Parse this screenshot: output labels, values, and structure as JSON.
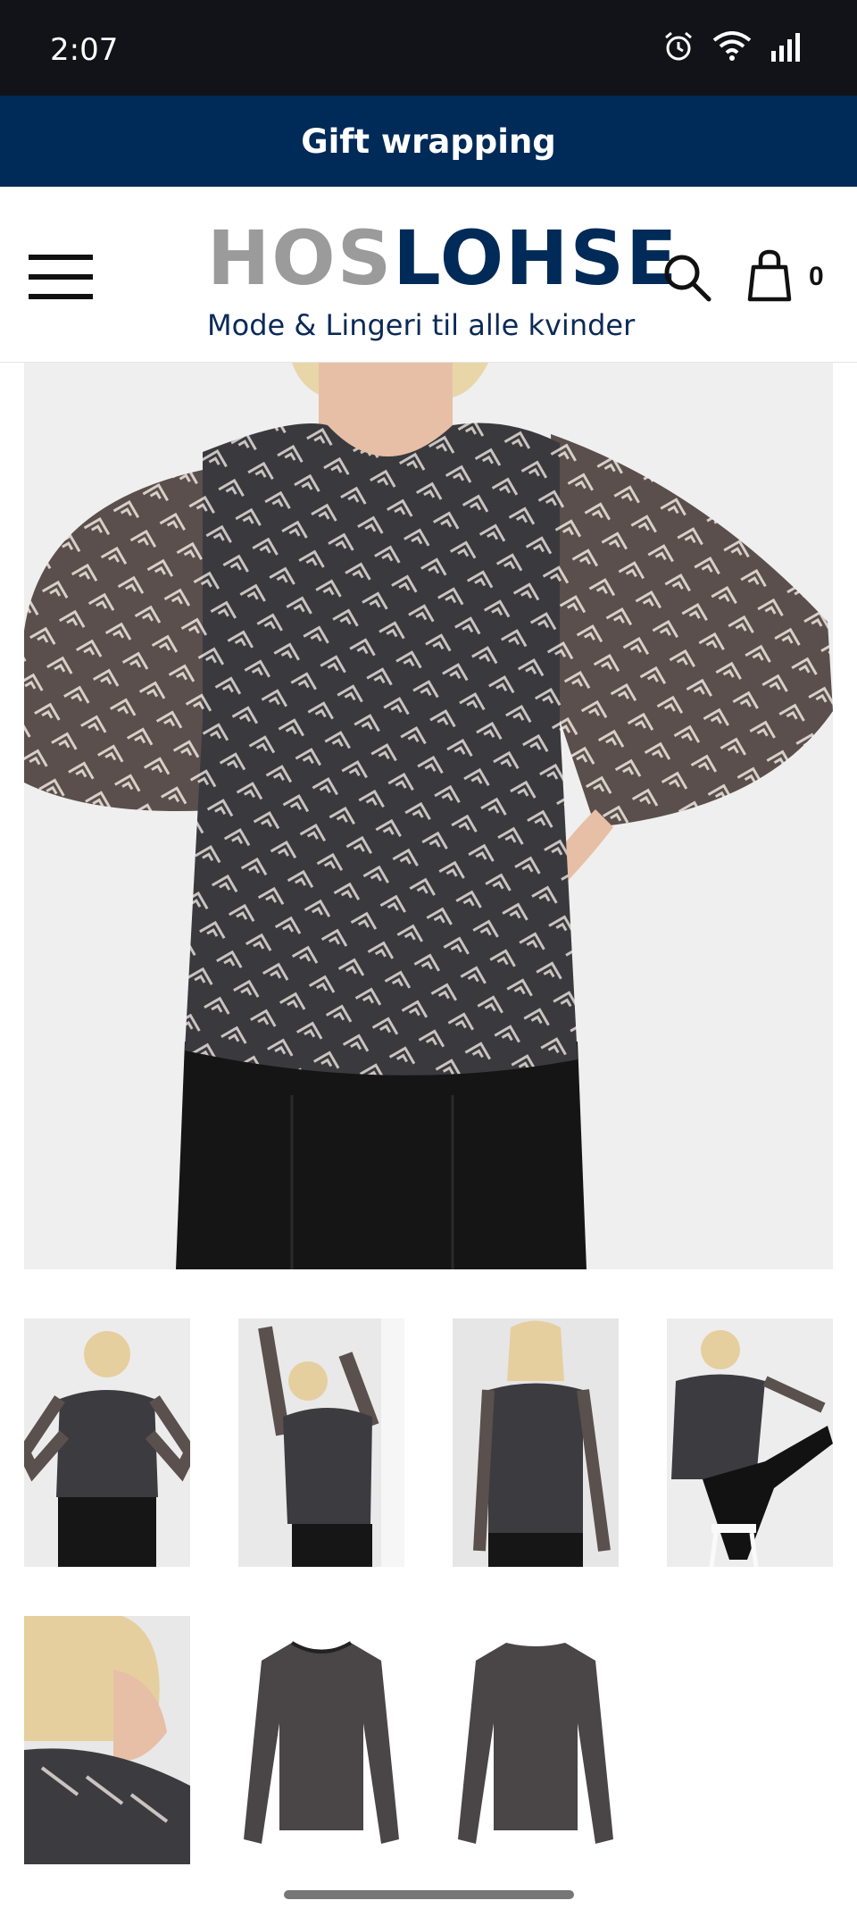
{
  "status": {
    "time": "2:07"
  },
  "promo": {
    "text": "Gift wrapping"
  },
  "header": {
    "logo_part1": "HOS",
    "logo_part2": "LOHSE",
    "tagline": "Mode & Lingeri til alle kvinder",
    "cart_count": "0"
  },
  "icons": {
    "menu": "hamburger-icon",
    "search": "search-icon",
    "cart": "shopping-bag-icon",
    "alarm": "alarm-icon",
    "wifi": "wifi-icon",
    "signal": "signal-icon"
  },
  "gallery": {
    "thumbnail_count": 7
  },
  "colors": {
    "status_bar": "#121318",
    "brand_navy": "#002a57",
    "logo_grey": "#9b9b9b"
  }
}
